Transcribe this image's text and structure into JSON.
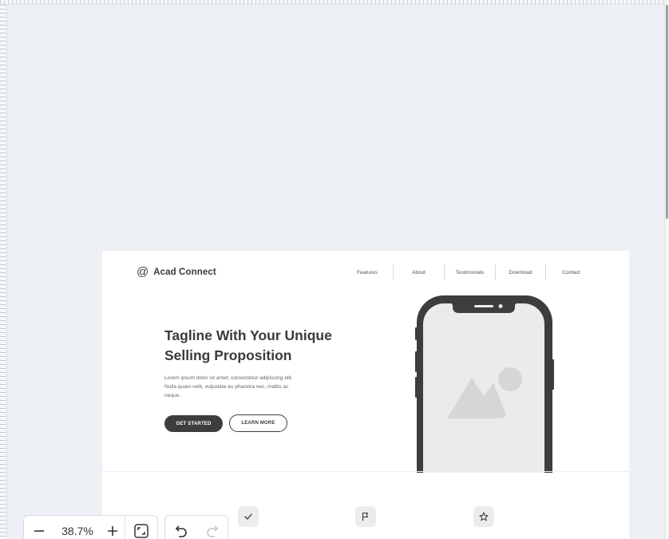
{
  "landing": {
    "brand_name": "Acad Connect",
    "nav": [
      "Features",
      "About",
      "Testimonials",
      "Download",
      "Contact"
    ],
    "hero_title": "Tagline With Your Unique Selling Proposition",
    "hero_text": "Lorem ipsum dolor sit amet, consectetur adipiscing elit. Nulla quam velit, vulputate eu pharetra nec, mattis ac neque.",
    "btn_primary": "GET STARTED",
    "btn_secondary": "LEARN MORE",
    "features": [
      {
        "icon": "check-icon"
      },
      {
        "icon": "flag-icon"
      },
      {
        "icon": "star-icon"
      }
    ]
  },
  "toolbar": {
    "zoom": "38.7%"
  },
  "colors": {
    "canvas": "#edf0f5",
    "dark": "#3d3d3d",
    "placeholder": "#d6d6d6"
  }
}
